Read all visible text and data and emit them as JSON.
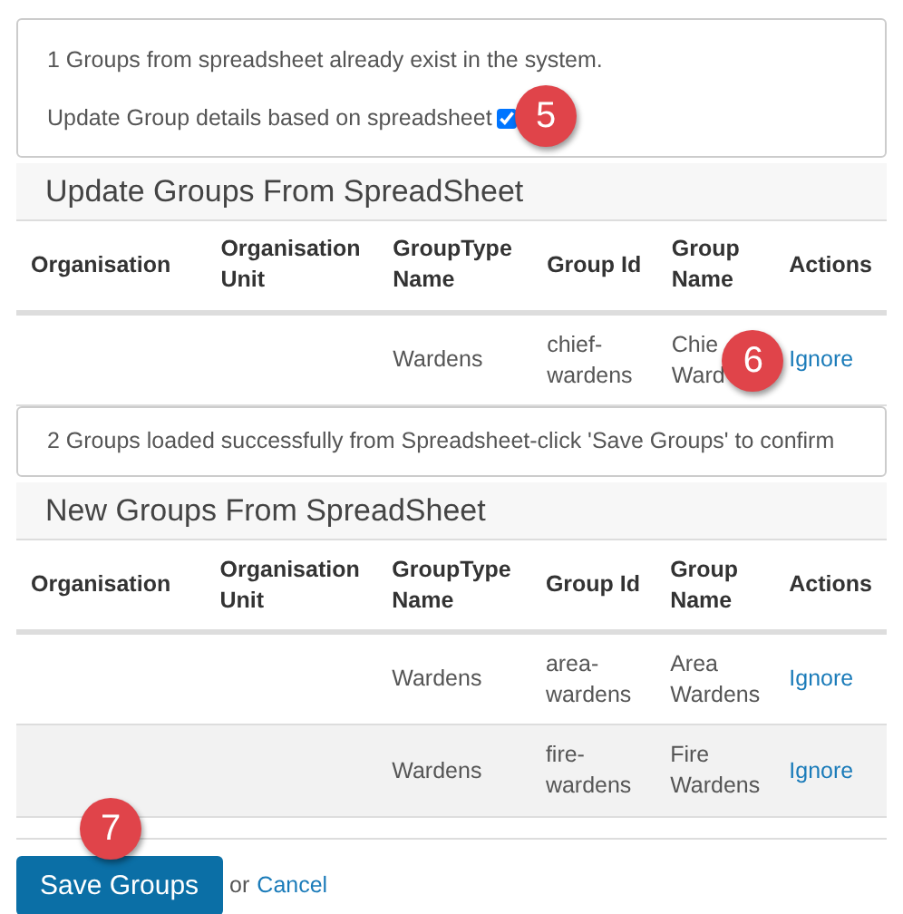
{
  "existing_notice": {
    "message": "1 Groups from spreadsheet already exist in the system.",
    "update_label": "Update Group details based on spreadsheet",
    "update_checked": true,
    "step_badge": "5"
  },
  "update_section": {
    "title": "Update Groups From SpreadSheet",
    "columns": [
      "Organisation",
      "Organisation Unit",
      "GroupType Name",
      "Group Id",
      "Group Name",
      "Actions"
    ],
    "rows": [
      {
        "organisation": "",
        "unit": "",
        "group_type": "Wardens",
        "group_id": "chief-wardens",
        "group_name": "Chie\nWard",
        "action": "Ignore",
        "step_badge": "6"
      }
    ]
  },
  "loaded_notice": {
    "message": "2 Groups loaded successfully from Spreadsheet-click 'Save Groups' to confirm"
  },
  "new_section": {
    "title": "New Groups From SpreadSheet",
    "columns": [
      "Organisation",
      "Organisation Unit",
      "GroupType Name",
      "Group Id",
      "Group Name",
      "Actions"
    ],
    "rows": [
      {
        "organisation": "",
        "unit": "",
        "group_type": "Wardens",
        "group_id": "area-wardens",
        "group_name": "Area Wardens",
        "action": "Ignore"
      },
      {
        "organisation": "",
        "unit": "",
        "group_type": "Wardens",
        "group_id": "fire-wardens",
        "group_name": "Fire Wardens",
        "action": "Ignore"
      }
    ]
  },
  "footer": {
    "save_label": "Save Groups",
    "save_badge": "7",
    "or_text": "or",
    "cancel_label": "Cancel"
  }
}
